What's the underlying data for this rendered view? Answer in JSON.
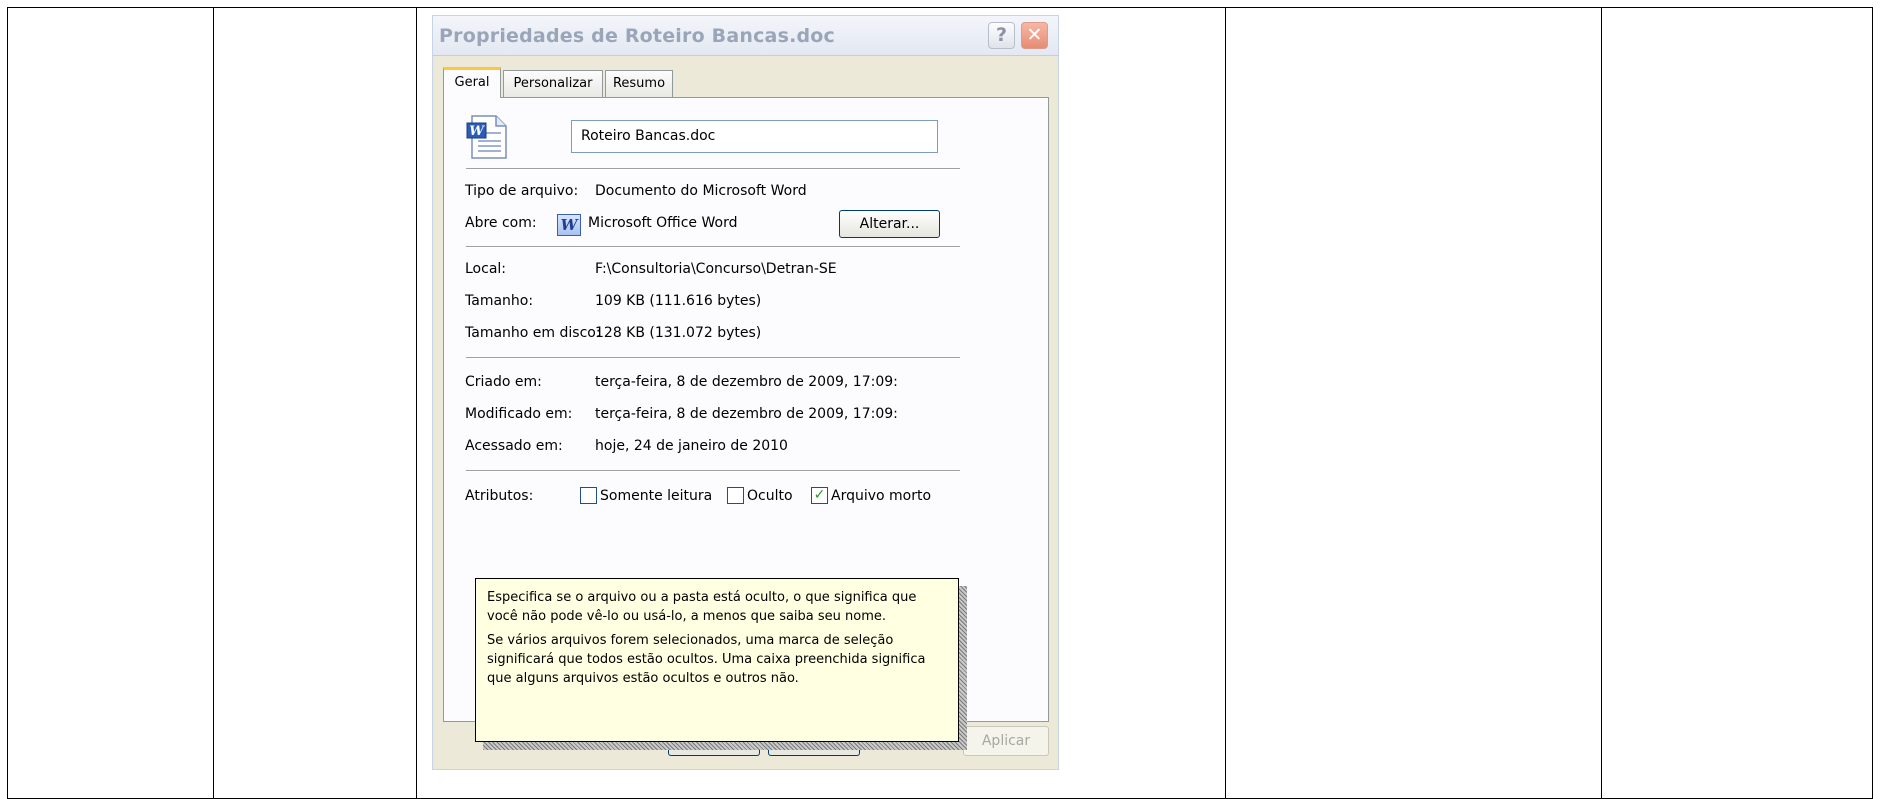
{
  "dialog": {
    "title": "Propriedades de Roteiro Bancas.doc",
    "help_glyph": "?",
    "close_glyph": "✕"
  },
  "tabs": [
    {
      "label": "Geral",
      "active": true
    },
    {
      "label": "Personalizar",
      "active": false
    },
    {
      "label": "Resumo",
      "active": false
    }
  ],
  "general": {
    "file_name": "Roteiro Bancas.doc",
    "file_type_label": "Tipo de arquivo:",
    "file_type_value": "Documento do Microsoft Word",
    "opens_with_label": "Abre com:",
    "opens_with_value": "Microsoft Office Word",
    "opens_with_icon": "word-app-icon",
    "change_button": "Alterar...",
    "location_label": "Local:",
    "location_value": "F:\\Consultoria\\Concurso\\Detran-SE",
    "size_label": "Tamanho:",
    "size_value": "109 KB (111.616 bytes)",
    "disk_size_label": "Tamanho em disco:",
    "disk_size_value": "128 KB (131.072 bytes)",
    "created_label": "Criado em:",
    "created_value": "terça-feira, 8 de dezembro de 2009, 17:09:",
    "modified_label": "Modificado em:",
    "modified_value": "terça-feira, 8 de dezembro de 2009, 17:09:",
    "accessed_label": "Acessado em:",
    "accessed_value": "hoje, 24 de janeiro de 2010",
    "attributes_label": "Atributos:",
    "attributes": [
      {
        "label": "Somente leitura",
        "checked": false
      },
      {
        "label": "Oculto",
        "checked": false
      },
      {
        "label": "Arquivo morto",
        "checked": true
      }
    ],
    "check_glyph": "✓"
  },
  "buttons": {
    "apply": "Aplicar"
  },
  "tooltip": {
    "paragraph1": "Especifica se o arquivo ou a pasta está oculto, o que significa que você não pode vê-lo ou usá-lo, a menos que saiba seu nome.",
    "paragraph2": "Se vários arquivos forem selecionados, uma marca de seleção significará que todos estão ocultos. Uma caixa preenchida significa que alguns arquivos estão ocultos e outros não."
  }
}
